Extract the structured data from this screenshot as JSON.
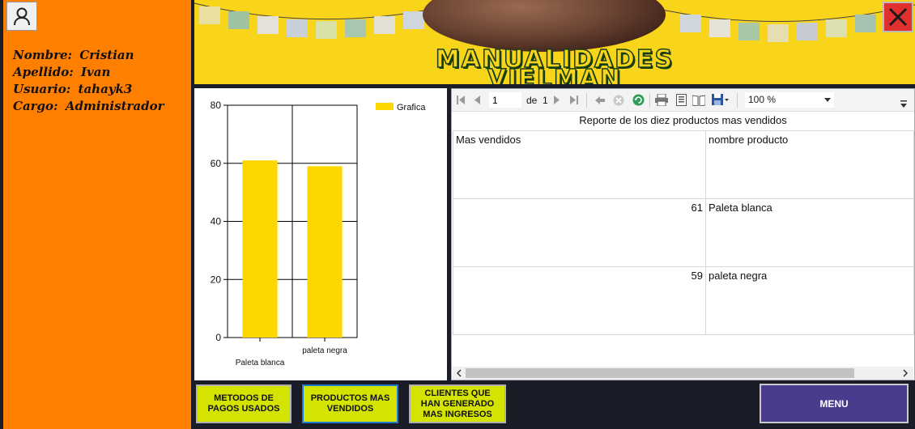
{
  "user": {
    "icon": "user-icon",
    "rows": [
      {
        "label": "Nombre:",
        "value": "Cristian"
      },
      {
        "label": "Apellido:",
        "value": "Ivan"
      },
      {
        "label": "Usuario:",
        "value": "tahayk3"
      },
      {
        "label": "Cargo:",
        "value": "Administrador"
      }
    ]
  },
  "banner": {
    "title_line1": "MANUALIDADES",
    "title_line2": "VIELMAN",
    "colors": {
      "background": "#f8d51b",
      "title_outline": "#173d14"
    }
  },
  "close_icon": "close-icon",
  "chart_data": {
    "type": "bar",
    "categories": [
      "Paleta blanca",
      "paleta negra"
    ],
    "series": [
      {
        "name": "Grafica",
        "values": [
          61,
          59
        ]
      }
    ],
    "ylim": [
      0,
      80
    ],
    "yticks": [
      "0",
      "20",
      "40",
      "60",
      "80"
    ],
    "grid": true,
    "legend": "top-right",
    "bar_color": "#ffd700"
  },
  "report": {
    "page": "1",
    "of_label": "de",
    "total_pages": "1",
    "zoom": "100 %",
    "title": "Reporte de los diez productos mas vendidos",
    "columns": [
      "Mas vendidos",
      "nombre producto"
    ],
    "rows": [
      {
        "count": "61",
        "name": "Paleta blanca"
      },
      {
        "count": "59",
        "name": "paleta negra"
      }
    ],
    "toolbar_icons": [
      "first-page-icon",
      "prev-page-icon",
      "next-page-icon",
      "last-page-icon",
      "back-icon",
      "stop-icon",
      "refresh-icon",
      "print-icon",
      "print-layout-icon",
      "page-setup-icon",
      "export-icon"
    ]
  },
  "buttons": {
    "metodos": "METODOS DE PAGOS USADOS",
    "productos": "PRODUCTOS MAS VENDIDOS",
    "clientes": "CLIENTES QUE HAN GENERADO MAS INGRESOS",
    "menu": "MENU"
  }
}
